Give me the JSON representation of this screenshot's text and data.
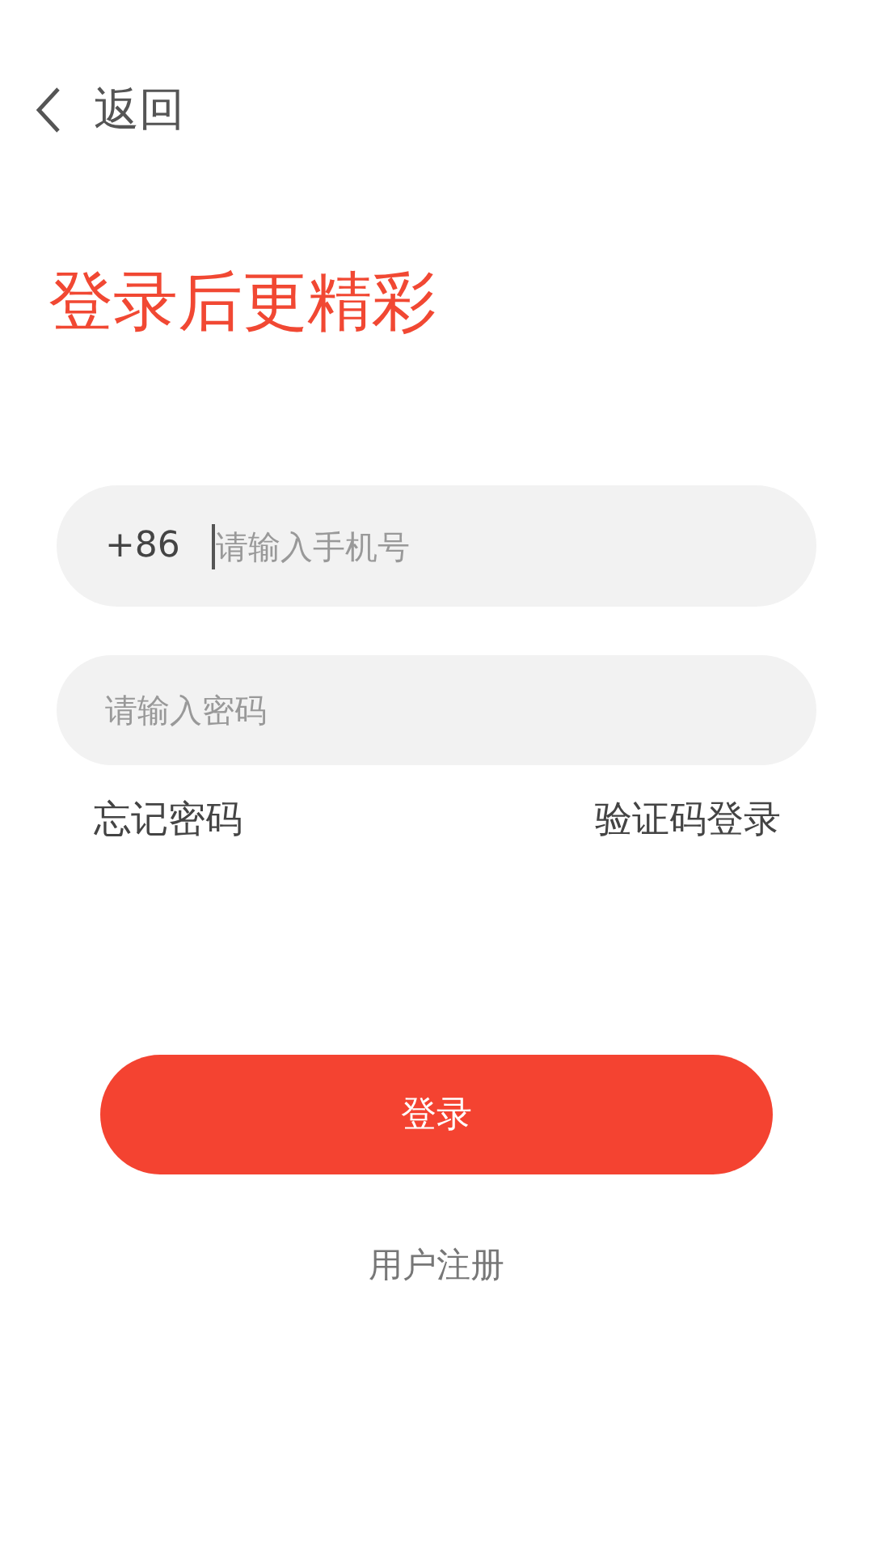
{
  "header": {
    "back_label": "返回"
  },
  "title": "登录后更精彩",
  "phone_field": {
    "prefix": "+86",
    "placeholder": "请输入手机号",
    "focused": true
  },
  "password_field": {
    "placeholder": "请输入密码"
  },
  "links": [
    "忘记密码",
    "验证码登录"
  ],
  "login_button": "登录",
  "register_link": "用户注册"
}
